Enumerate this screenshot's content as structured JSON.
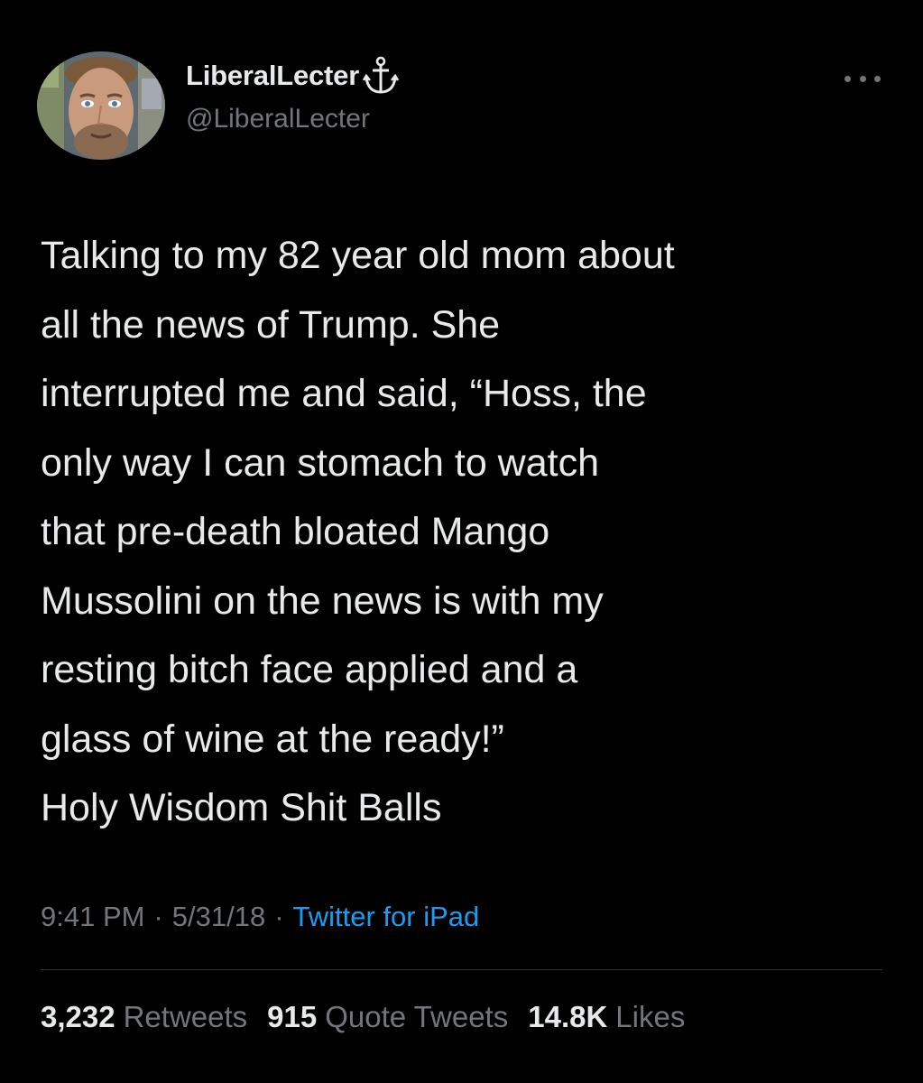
{
  "colors": {
    "background": "#000000",
    "primary_text": "#e7e9ea",
    "secondary_text": "#71767b",
    "link": "#1d9bf0",
    "divider": "#2f3336"
  },
  "author": {
    "display_name": "LiberalLecter",
    "badge_icon": "anchor-icon",
    "handle": "@LiberalLecter",
    "avatar_icon": "avatar"
  },
  "tweet": {
    "lines": [
      "Talking to my 82 year old mom about",
      "all the news of Trump. She",
      "interrupted me and said, “Hoss, the",
      "only way I can stomach to watch",
      "that pre-death bloated Mango",
      "Mussolini on the news is with my",
      "resting bitch face applied and a",
      "glass of wine at the ready!”",
      "Holy Wisdom Shit Balls"
    ]
  },
  "meta": {
    "time": "9:41 PM",
    "separator": "·",
    "date": "5/31/18",
    "source": "Twitter for iPad"
  },
  "stats": {
    "retweets": {
      "count": "3,232",
      "label": "Retweets"
    },
    "quotes": {
      "count": "915",
      "label": "Quote Tweets"
    },
    "likes": {
      "count": "14.8K",
      "label": "Likes"
    }
  }
}
